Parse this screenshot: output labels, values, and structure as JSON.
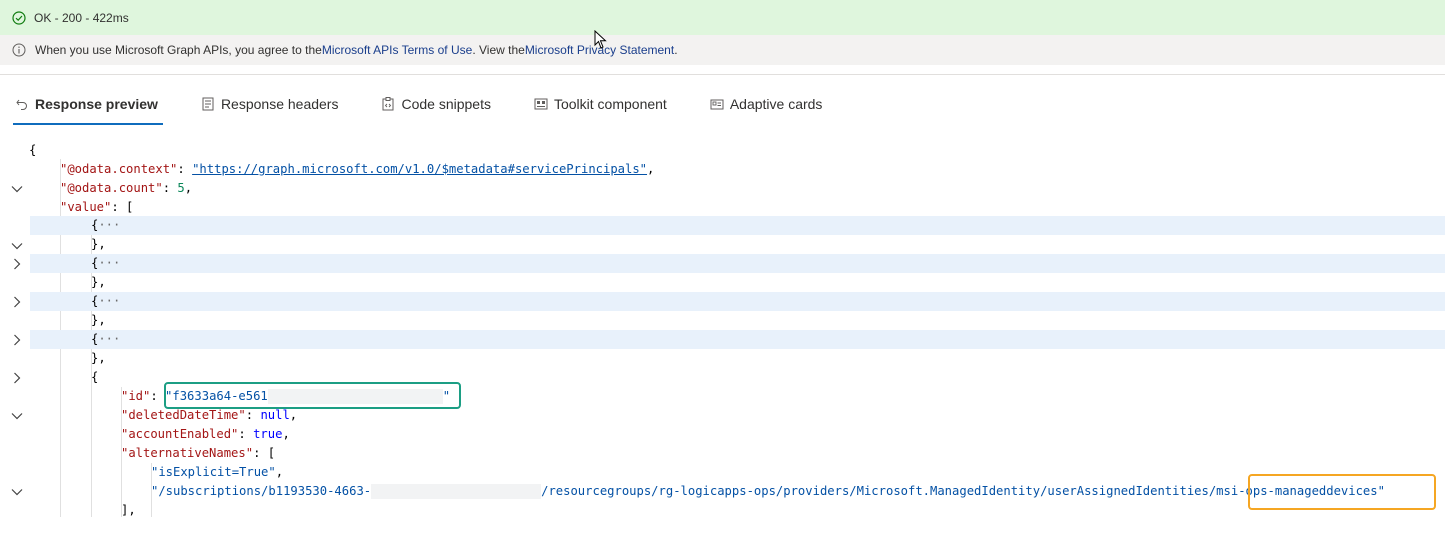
{
  "status": {
    "text": "OK - 200 - 422ms",
    "color": "#dff6dd"
  },
  "info": {
    "prefix": "When you use Microsoft Graph APIs, you agree to the ",
    "terms_link": "Microsoft APIs Terms of Use",
    "middle": ". View the ",
    "privacy_link": "Microsoft Privacy Statement",
    "suffix": "."
  },
  "tabs": [
    {
      "label": "Response preview",
      "icon": "undo-arrow-icon",
      "active": true
    },
    {
      "label": "Response headers",
      "icon": "document-icon",
      "active": false
    },
    {
      "label": "Code snippets",
      "icon": "clipboard-icon",
      "active": false
    },
    {
      "label": "Toolkit component",
      "icon": "toolkit-icon",
      "active": false
    },
    {
      "label": "Adaptive cards",
      "icon": "card-icon",
      "active": false
    }
  ],
  "json": {
    "open_brace": "{",
    "context_key": "\"@odata.context\"",
    "context_val": "\"https://graph.microsoft.com/v1.0/$metadata#servicePrincipals\"",
    "count_key": "\"@odata.count\"",
    "count_val": "5",
    "value_key": "\"value\"",
    "collapsed": "{",
    "ellipsis": "···",
    "close_item": "},",
    "item_open": "{",
    "id_key": "\"id\"",
    "id_val": "\"f3633a64-e561",
    "quote": "\"",
    "deleted_key": "\"deletedDateTime\"",
    "deleted_val": "null",
    "enabled_key": "\"accountEnabled\"",
    "enabled_val": "true",
    "alt_key": "\"alternativeNames\"",
    "alt_1": "\"isExplicit=True\"",
    "alt_2a": "\"/subscriptions/b1193530-4663-",
    "alt_2b": "/resourcegroups/rg-logicapps-ops/providers/Microsoft.ManagedIdentity/userAssignedIdentities",
    "alt_2c": "/msi-ops-manageddevices\"",
    "alt_close": "],"
  }
}
